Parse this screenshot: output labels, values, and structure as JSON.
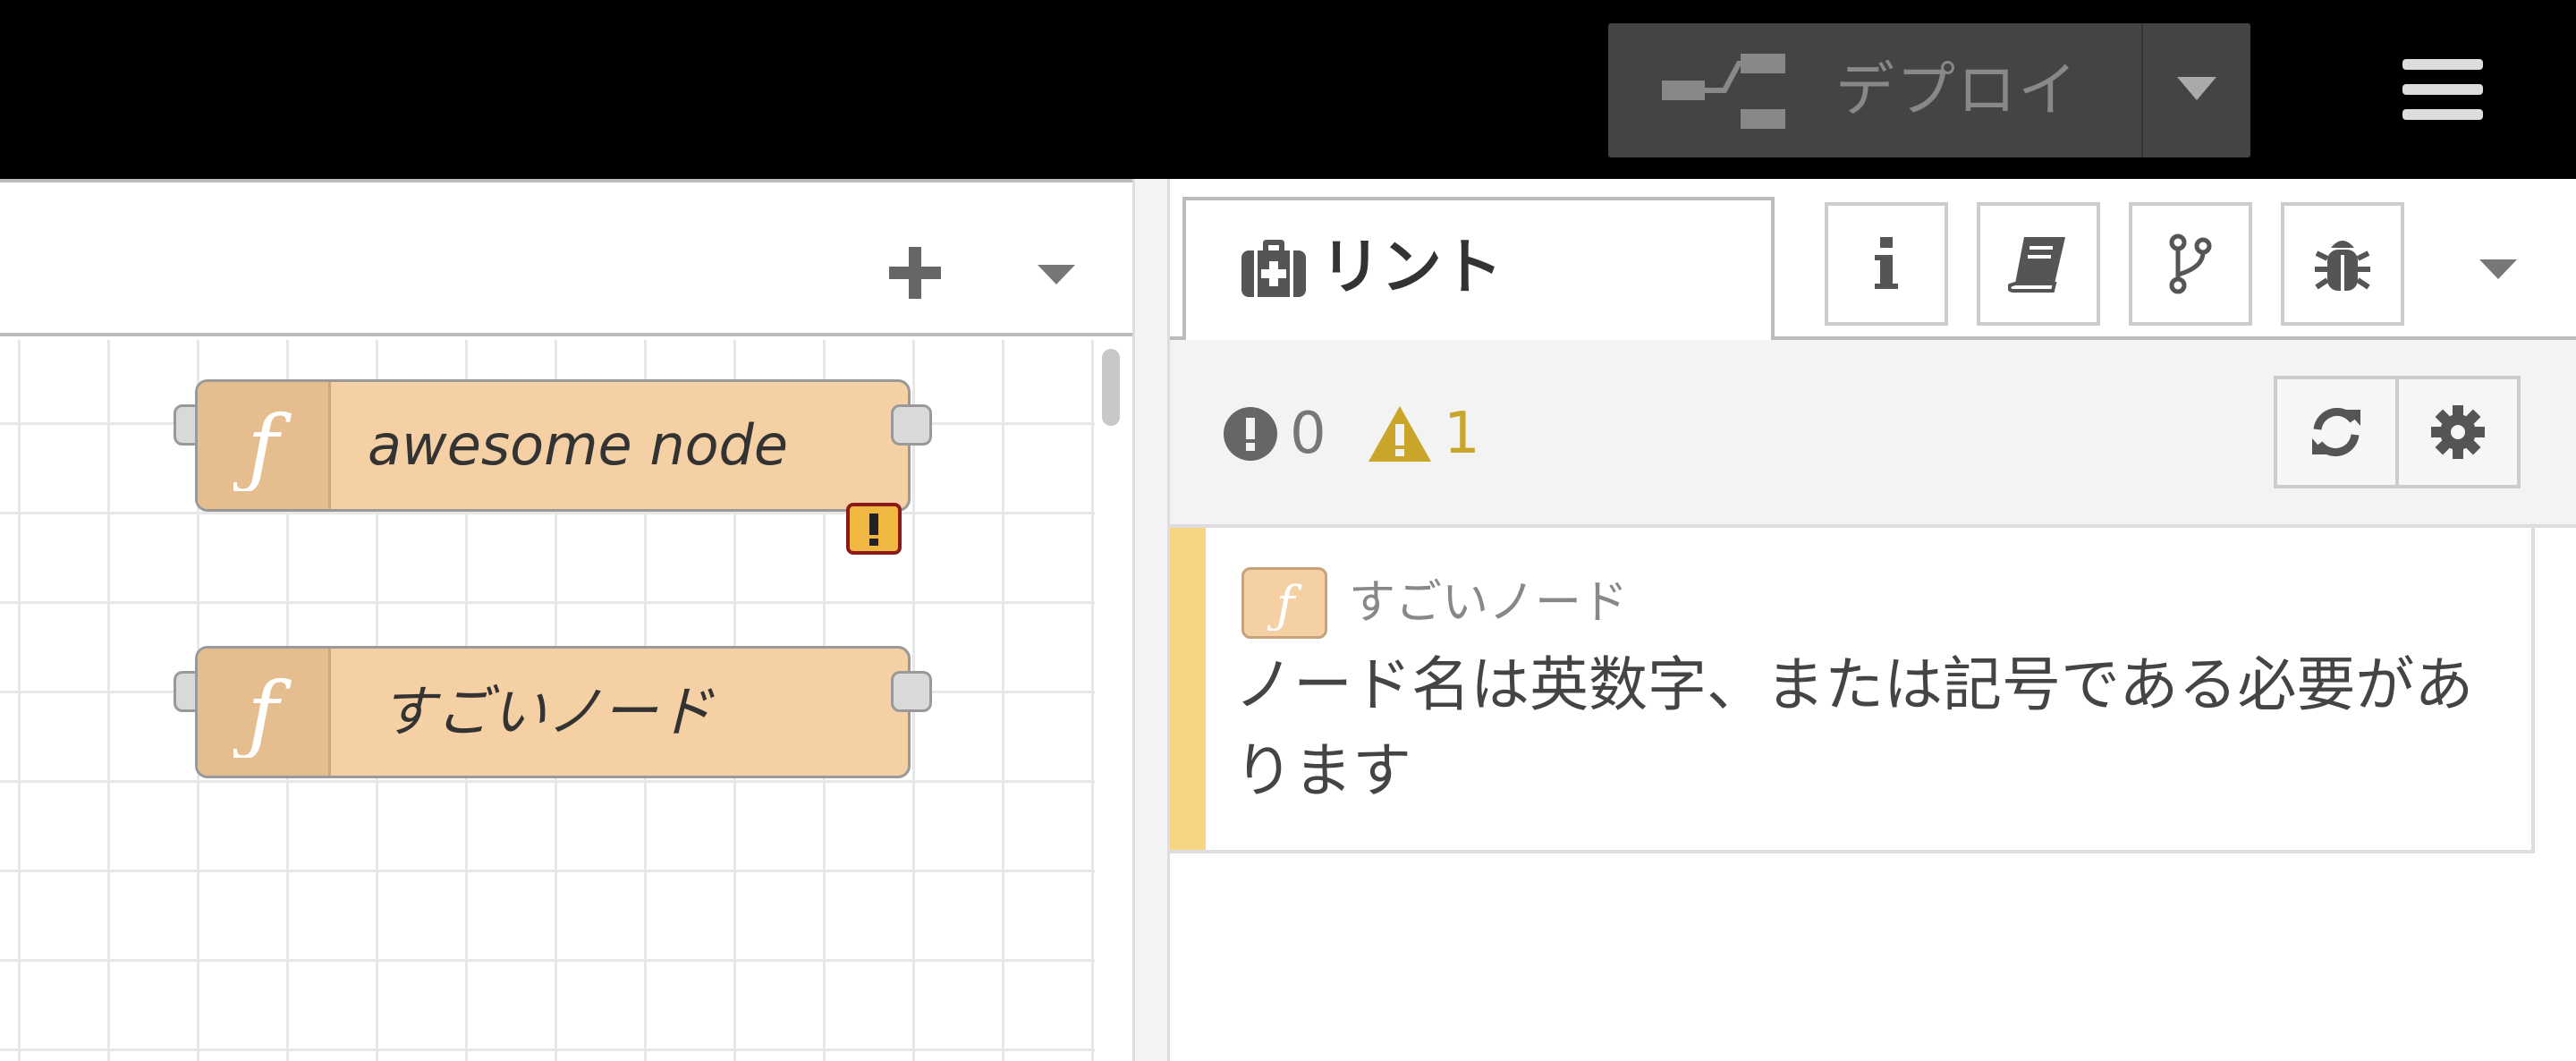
{
  "header": {
    "deploy_label": "デプロイ",
    "deploy_icon": "deploy-icon",
    "menu_icon": "hamburger-icon"
  },
  "workspace": {
    "add_icon": "plus-icon",
    "nodes": [
      {
        "label": "awesome node",
        "icon": "function-icon",
        "has_warning": false
      },
      {
        "label": "すごいノード",
        "icon": "function-icon",
        "has_warning": true
      }
    ],
    "colors": {
      "node_fill": "#f4d0a4",
      "node_icon_fill": "#e6bd8f",
      "warning_badge": "#f0b840"
    }
  },
  "sidebar": {
    "active_tab": {
      "label": "リント",
      "icon": "first-aid-kit-icon"
    },
    "tab_buttons": [
      "info-icon",
      "book-icon",
      "branch-icon",
      "bug-icon"
    ],
    "toolbar": {
      "error_count": "0",
      "warning_count": "1",
      "refresh_icon": "refresh-icon",
      "settings_icon": "gear-icon"
    },
    "lint_items": [
      {
        "node_name": "すごいノード",
        "message": "ノード名は英数字、または記号である必要があります",
        "severity_color": "#f8d585"
      }
    ]
  }
}
